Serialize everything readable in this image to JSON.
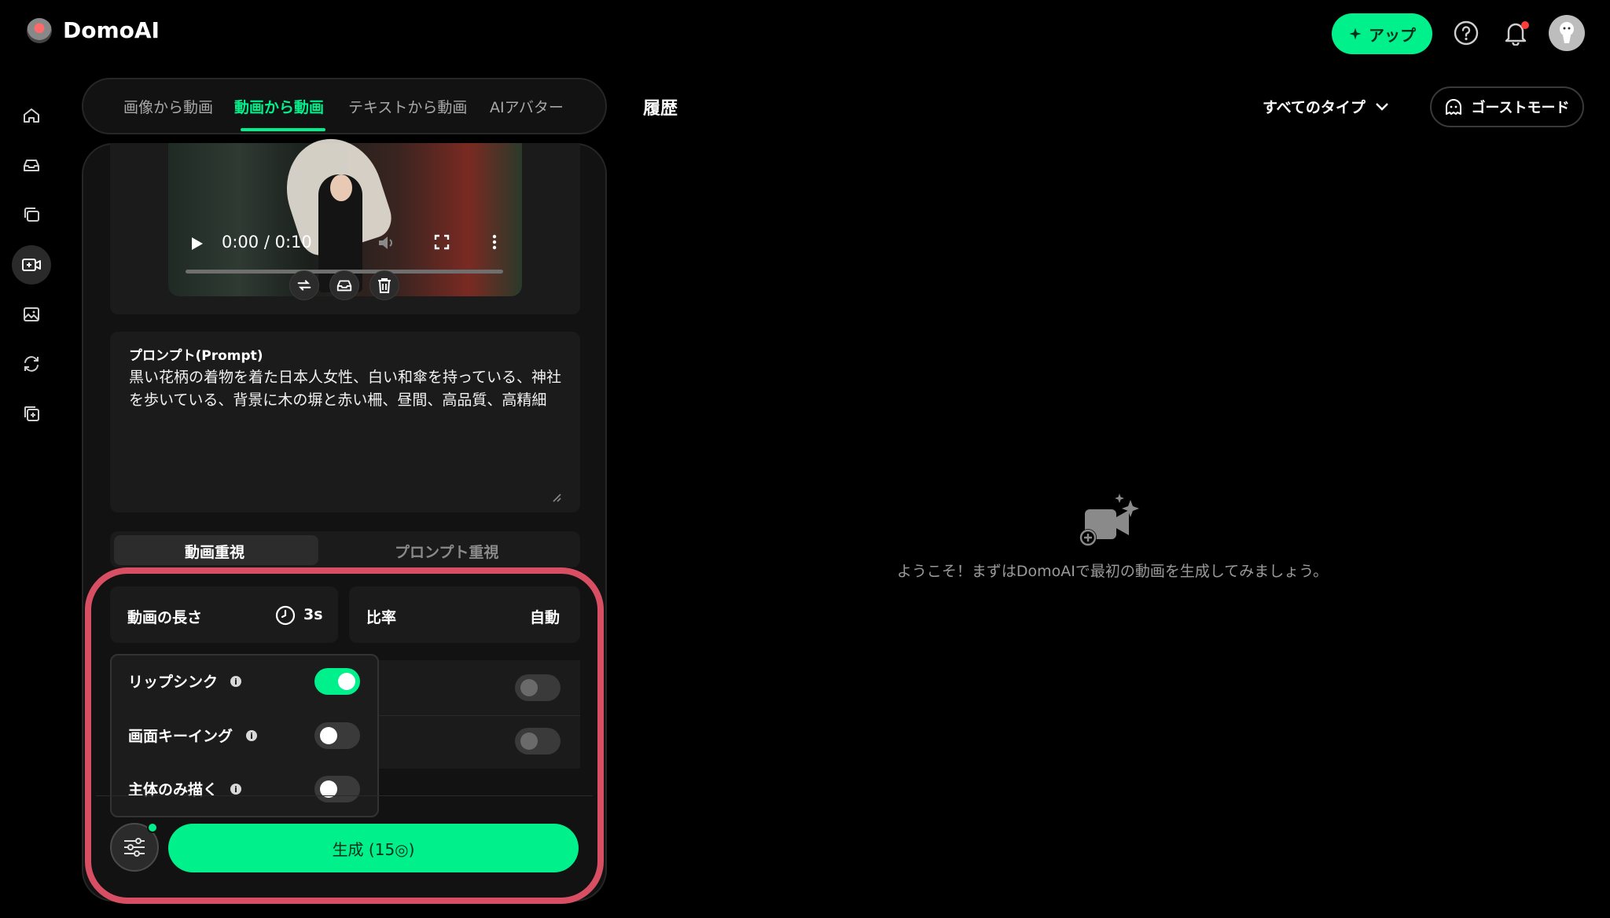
{
  "brand": {
    "name": "DomoAI"
  },
  "header": {
    "upgrade_label": "アップ"
  },
  "tabs": [
    {
      "label": "画像から動画"
    },
    {
      "label": "動画から動画"
    },
    {
      "label": "テキストから動画"
    },
    {
      "label": "AIアバター"
    }
  ],
  "video": {
    "time": "0:00 / 0:10"
  },
  "prompt": {
    "label": "プロンプト(Prompt)",
    "text": "黒い花柄の着物を着た日本人女性、白い和傘を持っている、神社を歩いている、背景に木の塀と赤い柵、昼間、高品質、高精細"
  },
  "mode": {
    "option_1": "動画重視",
    "option_2": "プロンプト重視"
  },
  "duration": {
    "label": "動画の長さ",
    "value": "3s"
  },
  "ratio": {
    "label": "比率",
    "value": "自動"
  },
  "options": [
    {
      "label": "リップシンク",
      "on": true
    },
    {
      "label": "画面キーイング",
      "on": false
    },
    {
      "label": "主体のみ描く",
      "on": false
    }
  ],
  "generate": {
    "label": "生成 (15◎)"
  },
  "history": {
    "title": "履歴",
    "type_filter": "すべてのタイプ",
    "ghost_mode": "ゴーストモード",
    "empty_message": "ようこそ！まずはDomoAIで最初の動画を生成してみましょう。"
  },
  "colors": {
    "accent": "#00f08c",
    "highlight": "#d84f63",
    "notification": "#ff3b3b"
  }
}
